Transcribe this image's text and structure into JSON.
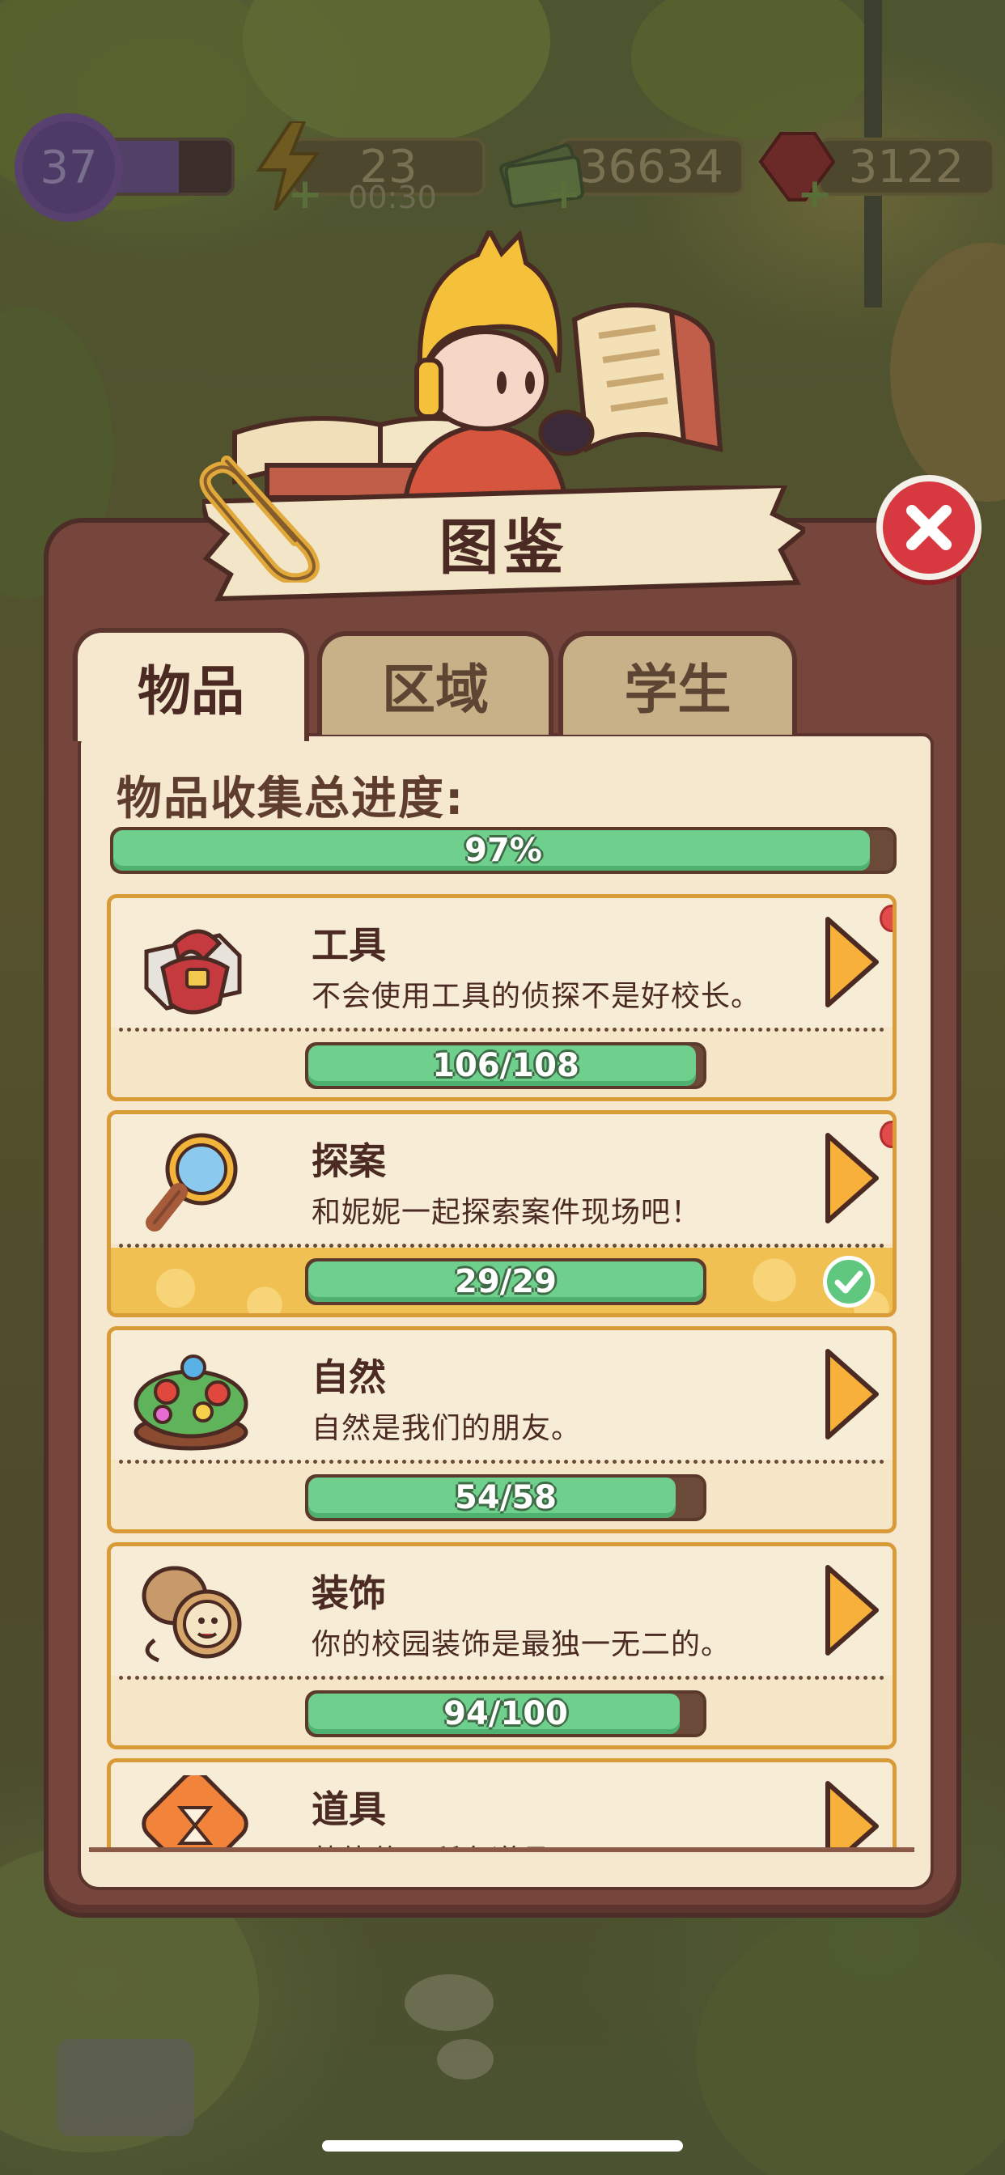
{
  "hud": {
    "level": "37",
    "energy": "23",
    "energy_timer": "00:30",
    "cash": "36634",
    "gems": "3122"
  },
  "panel": {
    "title": "图鉴",
    "tabs": [
      {
        "label": "物品",
        "active": true
      },
      {
        "label": "区域",
        "active": false
      },
      {
        "label": "学生",
        "active": false
      }
    ],
    "overall_label": "物品收集总进度:",
    "overall_progress_text": "97%",
    "overall_progress": 0.97
  },
  "categories": [
    {
      "name": "工具",
      "desc": "不会使用工具的侦探不是好校长。",
      "progress_text": "106/108",
      "progress": 0.981,
      "icon": "toolbox-icon",
      "badge": true,
      "complete": false
    },
    {
      "name": "探案",
      "desc": "和妮妮一起探索案件现场吧！",
      "progress_text": "29/29",
      "progress": 1.0,
      "icon": "magnifier-icon",
      "badge": true,
      "complete": true
    },
    {
      "name": "自然",
      "desc": "自然是我们的朋友。",
      "progress_text": "54/58",
      "progress": 0.931,
      "icon": "flower-bed-icon",
      "badge": false,
      "complete": false
    },
    {
      "name": "装饰",
      "desc": "你的校园装饰是最独一无二的。",
      "progress_text": "94/100",
      "progress": 0.94,
      "icon": "pocket-watch-icon",
      "badge": false,
      "complete": false
    },
    {
      "name": "道具",
      "desc": "熟练使用所有道具",
      "progress_text": "",
      "progress": 0,
      "icon": "hourglass-icon",
      "badge": false,
      "complete": false
    }
  ],
  "colors": {
    "panel": "#76463c",
    "paper": "#f5e8cf",
    "progress_green": "#6fd08e",
    "card_border": "#d99b38",
    "close_red": "#d8383f"
  }
}
